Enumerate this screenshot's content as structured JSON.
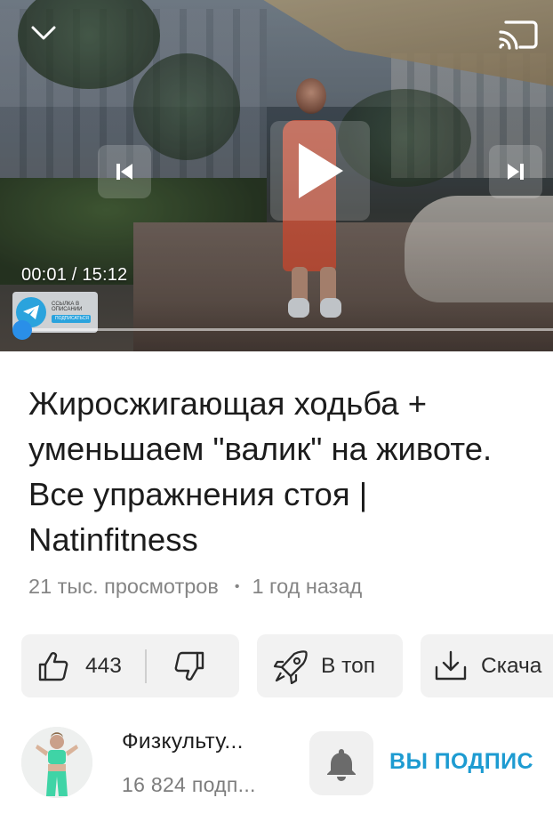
{
  "player": {
    "time": "00:01 / 15:12",
    "progress": 0.001,
    "badge": {
      "line1": "ССЫЛКА В ОПИСАНИИ",
      "line2": "ПОДПИСАТЬСЯ"
    },
    "accent_color": "#2a8fe8",
    "icons": [
      "chevron-down-icon",
      "cast-icon",
      "skip-previous-icon",
      "play-icon",
      "skip-next-icon",
      "telegram-icon"
    ]
  },
  "video": {
    "title": "Жиросжигающая ходьба + уменьшаем \"валик\" на животе. Все упражнения стоя | Natinfitness",
    "views": "21 тыс. просмотров",
    "separator": "•",
    "age": "1 год назад"
  },
  "actions": {
    "likes": "443",
    "to_top": "В топ",
    "download": "Скача"
  },
  "channel": {
    "name": "Физкульту...",
    "subscribers": "16 824 подп...",
    "subscribed_label": "ВЫ ПОДПИС",
    "subscribed_color": "#1d9bd1"
  }
}
